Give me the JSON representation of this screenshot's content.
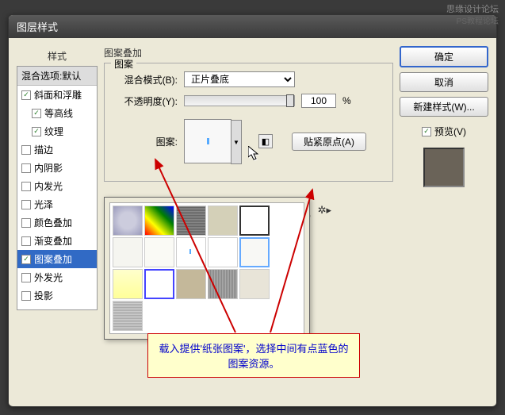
{
  "watermark1": "思缘设计论坛",
  "watermark2": "PS教程论坛",
  "dialog_title": "图层样式",
  "sidebar_heading": "样式",
  "blend_options_default": "混合选项:默认",
  "styles": [
    {
      "label": "斜面和浮雕",
      "checked": true,
      "sub": false
    },
    {
      "label": "等高线",
      "checked": true,
      "sub": true
    },
    {
      "label": "纹理",
      "checked": true,
      "sub": true
    },
    {
      "label": "描边",
      "checked": false,
      "sub": false
    },
    {
      "label": "内阴影",
      "checked": false,
      "sub": false
    },
    {
      "label": "内发光",
      "checked": false,
      "sub": false
    },
    {
      "label": "光泽",
      "checked": false,
      "sub": false
    },
    {
      "label": "颜色叠加",
      "checked": false,
      "sub": false
    },
    {
      "label": "渐变叠加",
      "checked": false,
      "sub": false
    },
    {
      "label": "图案叠加",
      "checked": true,
      "sub": false,
      "selected": true
    },
    {
      "label": "外发光",
      "checked": false,
      "sub": false
    },
    {
      "label": "投影",
      "checked": false,
      "sub": false
    }
  ],
  "main_title": "图案叠加",
  "fieldset_pattern": "图案",
  "blend_mode_label": "混合模式(B):",
  "blend_mode_value": "正片叠底",
  "opacity_label": "不透明度(Y):",
  "opacity_value": "100",
  "percent": "%",
  "pattern_label": "图案:",
  "snap_origin": "贴紧原点(A)",
  "buttons": {
    "ok": "确定",
    "cancel": "取消",
    "new_style": "新建样式(W)..."
  },
  "preview_label": "预览(V)",
  "annotation": "载入提供'纸张图案'，选择中间有点蓝色的图案资源。"
}
